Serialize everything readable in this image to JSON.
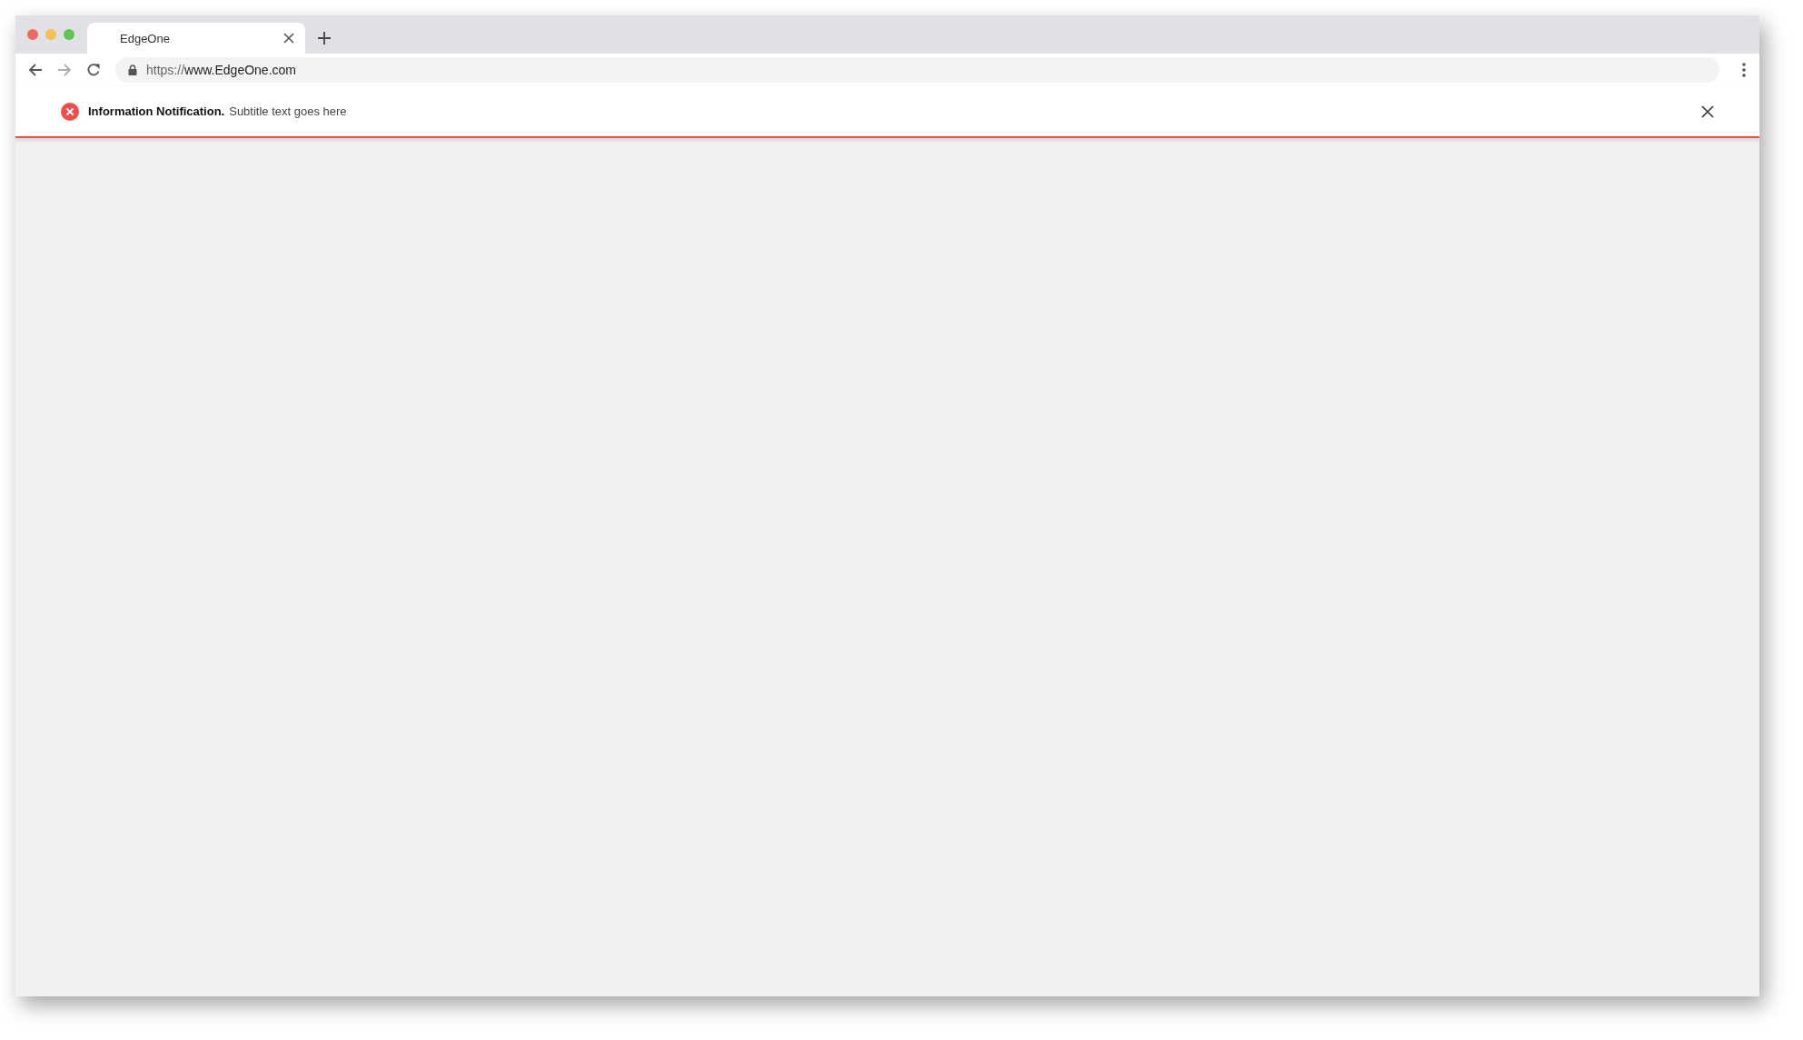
{
  "tabs": [
    {
      "title": "EdgeOne",
      "selected": true
    }
  ],
  "toolbar": {
    "back": {
      "disabled": false
    },
    "forward": {
      "disabled": true
    },
    "url": {
      "scheme": "https://",
      "host": "www.EdgeOne.com"
    }
  },
  "notification": {
    "kind": "error",
    "title": "Information Notification.",
    "subtitle": "Subtitle text goes here"
  }
}
